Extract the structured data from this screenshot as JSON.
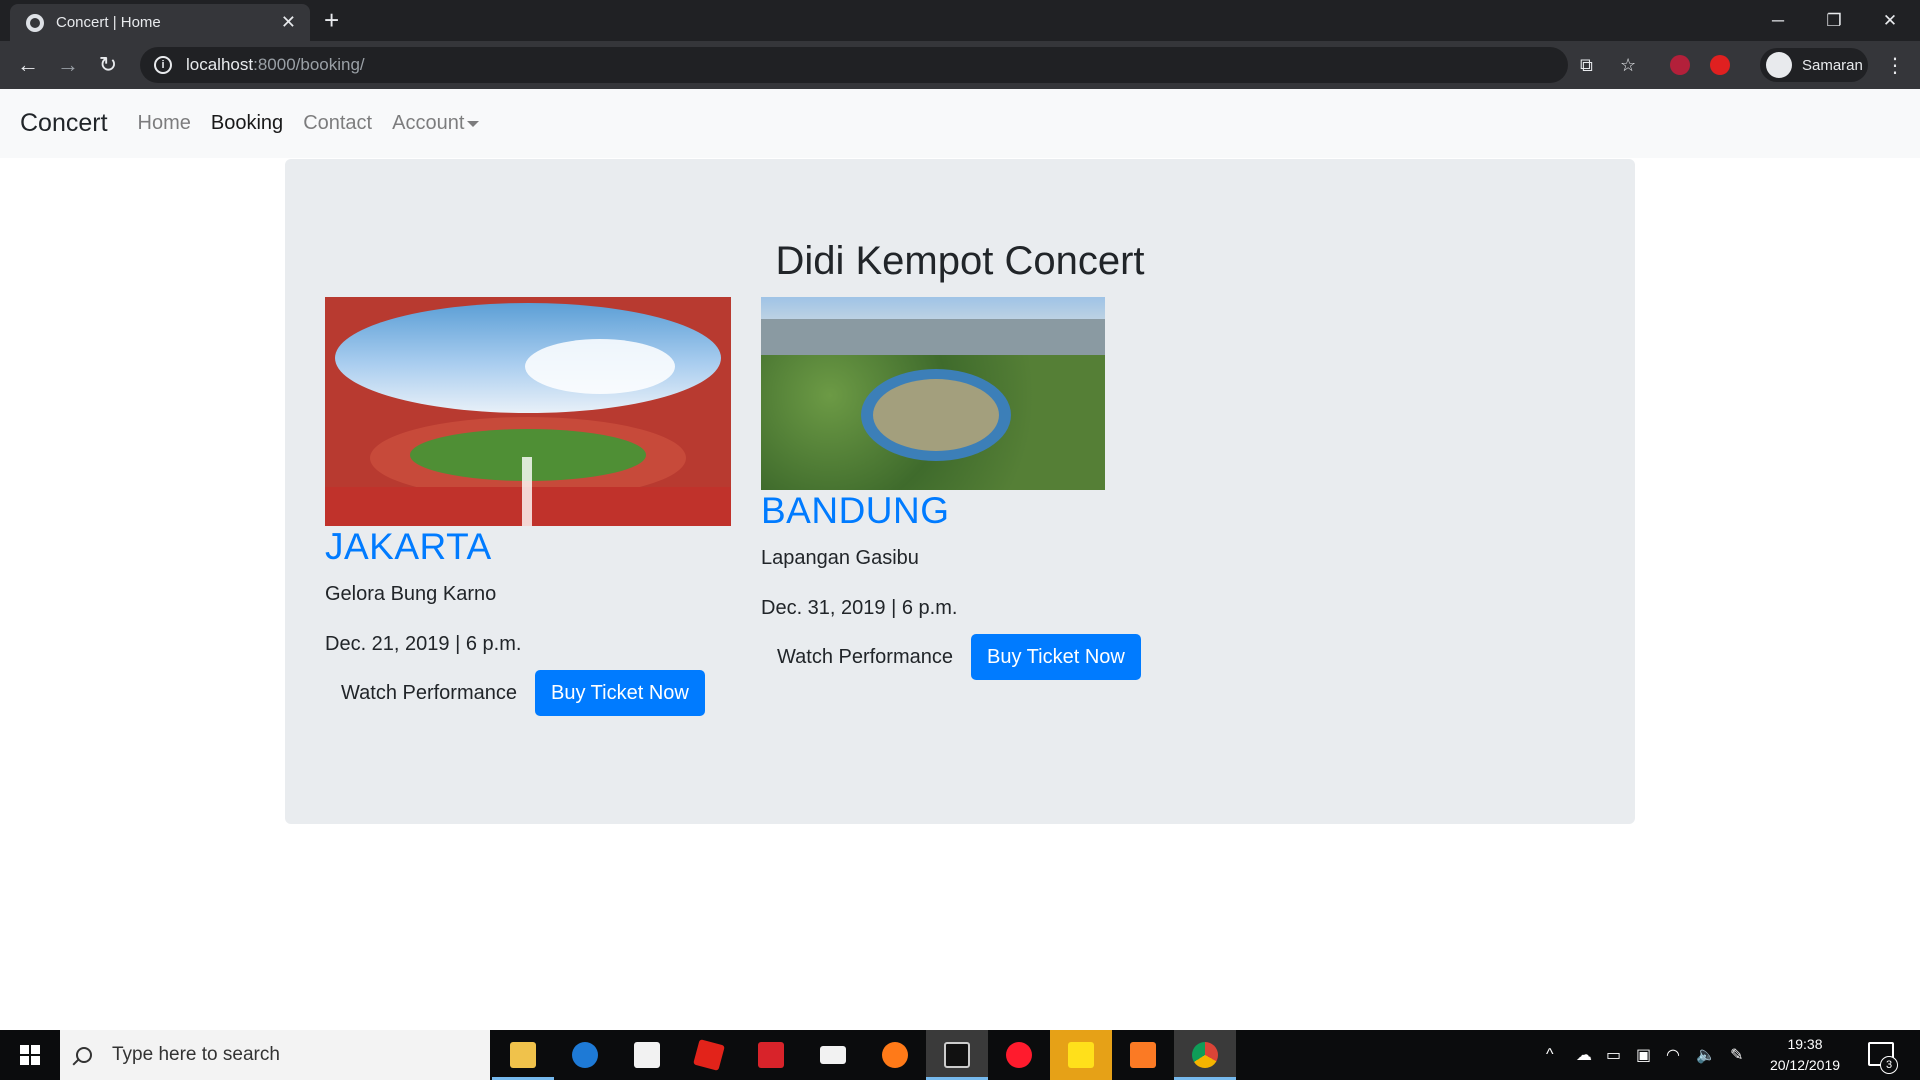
{
  "browser": {
    "tab_title": "Concert | Home",
    "url_host": "localhost",
    "url_path": ":8000/booking/",
    "profile_name": "Samaran"
  },
  "navbar": {
    "brand": "Concert",
    "links": [
      {
        "label": "Home"
      },
      {
        "label": "Booking"
      },
      {
        "label": "Contact"
      },
      {
        "label": "Account"
      }
    ]
  },
  "main": {
    "heading": "Didi Kempot Concert",
    "concerts": [
      {
        "city": "JAKARTA",
        "venue": "Gelora Bung Karno",
        "date": "Dec. 21, 2019 | 6 p.m.",
        "watch_label": "Watch Performance",
        "buy_label": "Buy Ticket Now"
      },
      {
        "city": "BANDUNG",
        "venue": "Lapangan Gasibu",
        "date": "Dec. 31, 2019 | 6 p.m.",
        "watch_label": "Watch Performance",
        "buy_label": "Buy Ticket Now"
      }
    ]
  },
  "taskbar": {
    "search_placeholder": "Type here to search",
    "time": "19:38",
    "date": "20/12/2019",
    "notification_count": "3"
  },
  "colors": {
    "primary": "#007bff",
    "jumbotron": "#e9ecef",
    "navbar": "#f8f9fa"
  }
}
